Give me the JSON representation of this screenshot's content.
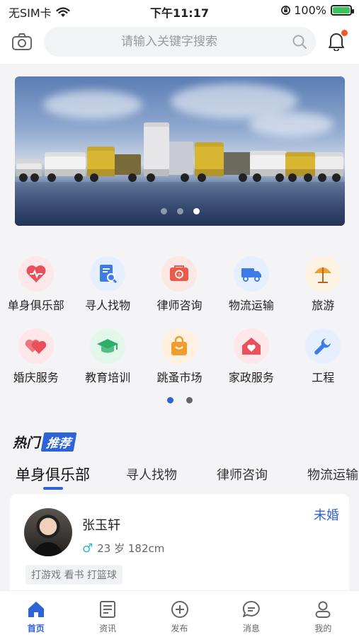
{
  "status_bar": {
    "carrier": "无SIM卡",
    "time": "下午11:17",
    "battery_percent": "100%"
  },
  "search": {
    "placeholder": "请输入关键字搜索"
  },
  "banner": {
    "dot_count": 3,
    "active_dot": 3
  },
  "categories": {
    "row1": [
      {
        "label": "单身俱乐部",
        "icon": "heart-pulse-icon",
        "bg": "#fde7ea",
        "color": "#e8505b"
      },
      {
        "label": "寻人找物",
        "icon": "search-document-icon",
        "bg": "#e6efff",
        "color": "#3b7bea"
      },
      {
        "label": "律师咨询",
        "icon": "consult-icon",
        "bg": "#fde7e4",
        "color": "#ee5a4a"
      },
      {
        "label": "物流运输",
        "icon": "truck-icon",
        "bg": "#e6efff",
        "color": "#3b7bea"
      },
      {
        "label": "旅游",
        "icon": "beach-umbrella-icon",
        "bg": "#fff2e2",
        "color": "#f0a030"
      }
    ],
    "row2": [
      {
        "label": "婚庆服务",
        "icon": "hearts-icon",
        "bg": "#fde7ea",
        "color": "#e8505b"
      },
      {
        "label": "教育培训",
        "icon": "graduation-cap-icon",
        "bg": "#e3f6ec",
        "color": "#2fae6a"
      },
      {
        "label": "跳蚤市场",
        "icon": "shopping-bag-icon",
        "bg": "#fff0e0",
        "color": "#f39c2c"
      },
      {
        "label": "家政服务",
        "icon": "home-heart-icon",
        "bg": "#fde7ea",
        "color": "#e8505b"
      },
      {
        "label": "工程",
        "icon": "wrench-icon",
        "bg": "#e6efff",
        "color": "#3b7bea"
      }
    ]
  },
  "hot": {
    "title_main": "热门",
    "title_tag": "推荐"
  },
  "tabs": [
    "单身俱乐部",
    "寻人找物",
    "律师咨询",
    "物流运输"
  ],
  "card": {
    "name": "张玉轩",
    "meta": "23 岁 182cm",
    "gender_symbol": "♂",
    "status": "未婚",
    "tags": "打游戏 看书 打篮球"
  },
  "nav": [
    {
      "label": "首页",
      "icon": "home-icon"
    },
    {
      "label": "资讯",
      "icon": "news-icon"
    },
    {
      "label": "发布",
      "icon": "plus-circle-icon"
    },
    {
      "label": "消息",
      "icon": "message-icon"
    },
    {
      "label": "我的",
      "icon": "user-icon"
    }
  ],
  "colors": {
    "accent": "#2e63d8",
    "notification": "#f05a28"
  }
}
